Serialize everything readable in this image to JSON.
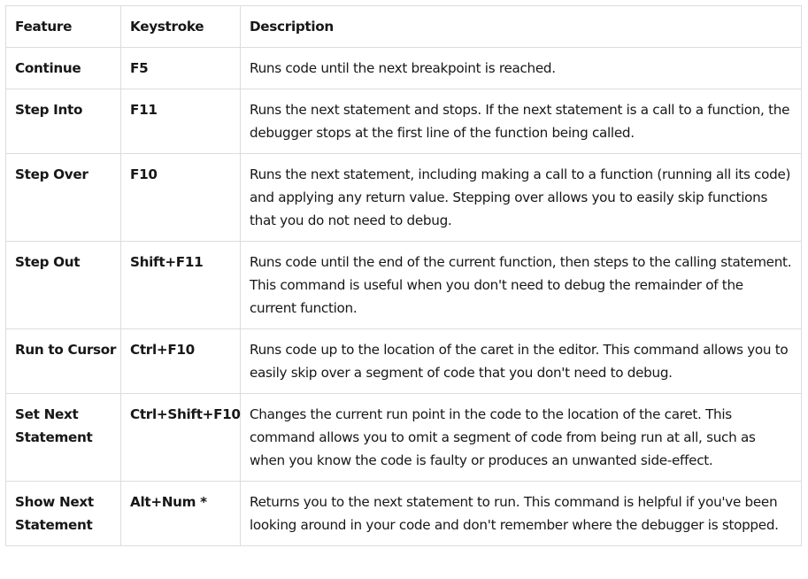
{
  "table": {
    "headers": [
      "Feature",
      "Keystroke",
      "Description"
    ],
    "rows": [
      {
        "feature": "Continue",
        "keystroke": "F5",
        "description": "Runs code until the next breakpoint is reached."
      },
      {
        "feature": "Step Into",
        "keystroke": "F11",
        "description": "Runs the next statement and stops. If the next statement is a call to a function, the debugger stops at the first line of the function being called."
      },
      {
        "feature": "Step Over",
        "keystroke": "F10",
        "description": "Runs the next statement, including making a call to a function (running all its code) and applying any return value. Stepping over allows you to easily skip functions that you do not need to debug."
      },
      {
        "feature": "Step Out",
        "keystroke": "Shift+F11",
        "description": "Runs code until the end of the current function, then steps to the calling statement. This command is useful when you don't need to debug the remainder of the current function."
      },
      {
        "feature": "Run to Cursor",
        "keystroke": "Ctrl+F10",
        "description": "Runs code up to the location of the caret in the editor. This command allows you to easily skip over a segment of code that you don't need to debug."
      },
      {
        "feature": "Set Next Statement",
        "keystroke": "Ctrl+Shift+F10",
        "description": "Changes the current run point in the code to the location of the caret. This command allows you to omit a segment of code from being run at all, such as when you know the code is faulty or produces an unwanted side-effect."
      },
      {
        "feature": "Show Next Statement",
        "keystroke": "Alt+Num *",
        "description": "Returns you to the next statement to run. This command is helpful if you've been looking around in your code and don't remember where the debugger is stopped."
      }
    ]
  }
}
